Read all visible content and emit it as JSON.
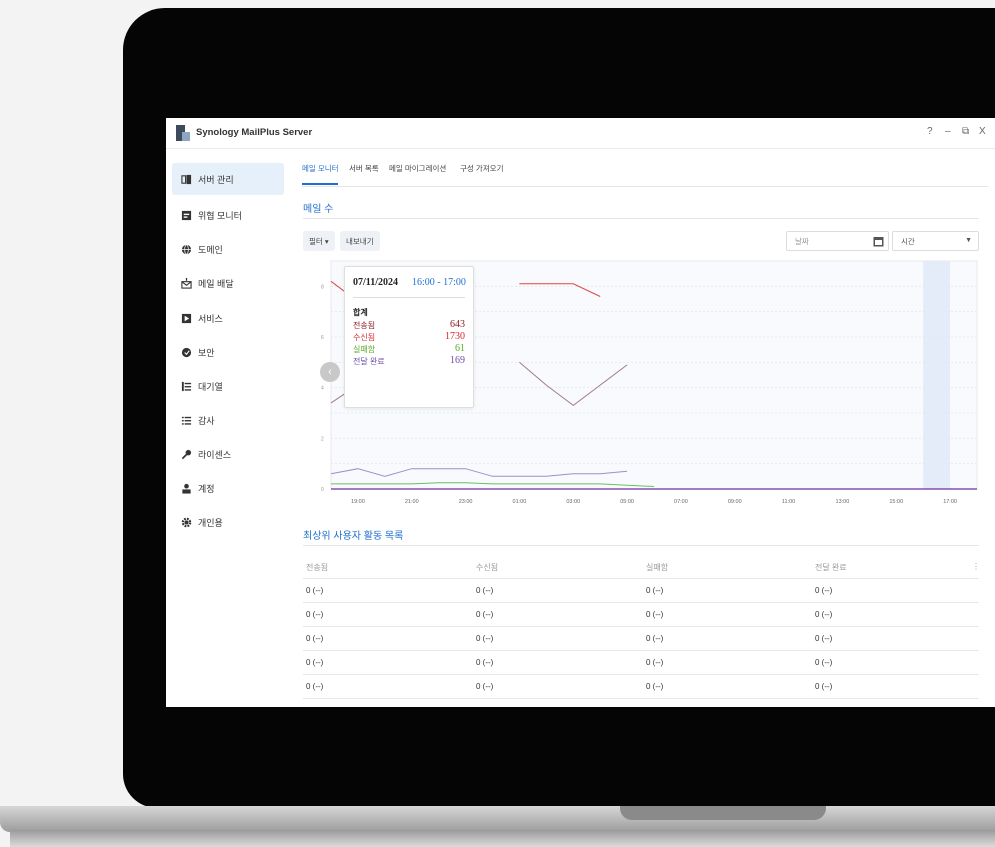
{
  "app": {
    "title": "Synology MailPlus Server"
  },
  "window_controls": {
    "help": "?",
    "minimize": "–",
    "restore": "⧉",
    "close": "X"
  },
  "sidebar": {
    "items": [
      {
        "label": "서버 관리",
        "icon": "server-icon"
      },
      {
        "label": "위협 모니터",
        "icon": "monitor-icon"
      },
      {
        "label": "도메인",
        "icon": "globe-icon"
      },
      {
        "label": "메일 배달",
        "icon": "mail-delivery-icon"
      },
      {
        "label": "서비스",
        "icon": "service-icon"
      },
      {
        "label": "보안",
        "icon": "shield-icon"
      },
      {
        "label": "대기열",
        "icon": "queue-icon"
      },
      {
        "label": "감사",
        "icon": "audit-icon"
      },
      {
        "label": "라이센스",
        "icon": "key-icon"
      },
      {
        "label": "계정",
        "icon": "account-icon"
      },
      {
        "label": "개인용",
        "icon": "gear-icon"
      }
    ]
  },
  "tabs": [
    {
      "label": "메일 모니터"
    },
    {
      "label": "서버 목록"
    },
    {
      "label": "메일 마이그레이션"
    },
    {
      "label": "구성 가져오기"
    }
  ],
  "mail_count": {
    "title": "메일 수",
    "filter_label": "필터 ▾",
    "export_label": "내보내기",
    "date_placeholder": "날짜",
    "time_placeholder": "시간"
  },
  "tooltip": {
    "date": "07/11/2024",
    "time": "16:00 - 17:00",
    "sum_label": "합계",
    "rows": [
      {
        "label": "전송됨",
        "value": "643",
        "color": "#8b1a1a"
      },
      {
        "label": "수신됨",
        "value": "1730",
        "color": "#d9252a"
      },
      {
        "label": "실패함",
        "value": "61",
        "color": "#5aab2a"
      },
      {
        "label": "전달 완료",
        "value": "169",
        "color": "#6b4fa6"
      }
    ]
  },
  "chart_data": {
    "type": "line",
    "x": [
      "18:00",
      "19:00",
      "20:00",
      "21:00",
      "22:00",
      "23:00",
      "00:00",
      "01:00",
      "02:00",
      "03:00",
      "04:00",
      "05:00",
      "06:00",
      "07:00",
      "08:00",
      "09:00",
      "10:00",
      "11:00",
      "12:00",
      "13:00",
      "14:00",
      "15:00",
      "16:00",
      "17:00",
      "18:00"
    ],
    "x_tick_labels": [
      "19:00",
      "21:00",
      "23:00",
      "01:00",
      "03:00",
      "05:00",
      "07:00",
      "09:00",
      "11:00",
      "13:00",
      "15:00",
      "17:00"
    ],
    "y_tick_labels": [
      "0",
      "2",
      "4",
      "6",
      "8"
    ],
    "ylim": [
      0,
      9
    ],
    "series": [
      {
        "color": "#e0454a",
        "values": [
          8.2,
          7.4,
          null,
          null,
          null,
          null,
          null,
          8.1,
          8.1,
          8.1,
          7.6,
          null,
          null,
          null,
          null,
          null,
          null,
          null,
          null,
          null,
          null,
          null,
          null,
          null,
          null
        ]
      },
      {
        "color": "#9e7a8f",
        "values": [
          3.4,
          4.1,
          null,
          null,
          null,
          null,
          null,
          5.0,
          4.1,
          3.3,
          4.1,
          4.9,
          null,
          null,
          null,
          null,
          null,
          null,
          null,
          null,
          null,
          null,
          null,
          null,
          null
        ]
      },
      {
        "color": "#9a90c8",
        "values": [
          0.6,
          0.8,
          0.5,
          0.8,
          0.8,
          0.8,
          0.5,
          0.5,
          0.5,
          0.6,
          0.6,
          0.7,
          null,
          null,
          null,
          null,
          null,
          null,
          null,
          null,
          null,
          null,
          null,
          null,
          null
        ]
      },
      {
        "color": "#6cc05a",
        "values": [
          0.2,
          0.2,
          0.2,
          0.2,
          0.25,
          0.25,
          0.2,
          0.2,
          0.2,
          0.2,
          0.2,
          0.15,
          0.1,
          null,
          null,
          null,
          null,
          null,
          null,
          null,
          null,
          null,
          null,
          null,
          null
        ]
      },
      {
        "color": "#6b2fa0",
        "values": [
          0,
          0,
          0,
          0,
          0,
          0,
          0,
          0,
          0,
          0,
          0,
          0,
          0,
          0,
          0,
          0,
          0,
          0,
          0,
          0,
          0,
          0,
          0,
          0,
          0
        ]
      }
    ],
    "grid": true,
    "highlight_band": "16:00 - 17:00"
  },
  "top_users": {
    "title": "최상위 사용자 활동 목록",
    "columns": [
      "전송됨",
      "수신됨",
      "실패함",
      "전달 완료"
    ],
    "rows": [
      [
        "0 (--)",
        "0 (--)",
        "0 (--)",
        "0 (--)"
      ],
      [
        "0 (--)",
        "0 (--)",
        "0 (--)",
        "0 (--)"
      ],
      [
        "0 (--)",
        "0 (--)",
        "0 (--)",
        "0 (--)"
      ],
      [
        "0 (--)",
        "0 (--)",
        "0 (--)",
        "0 (--)"
      ],
      [
        "0 (--)",
        "0 (--)",
        "0 (--)",
        "0 (--)"
      ]
    ]
  }
}
